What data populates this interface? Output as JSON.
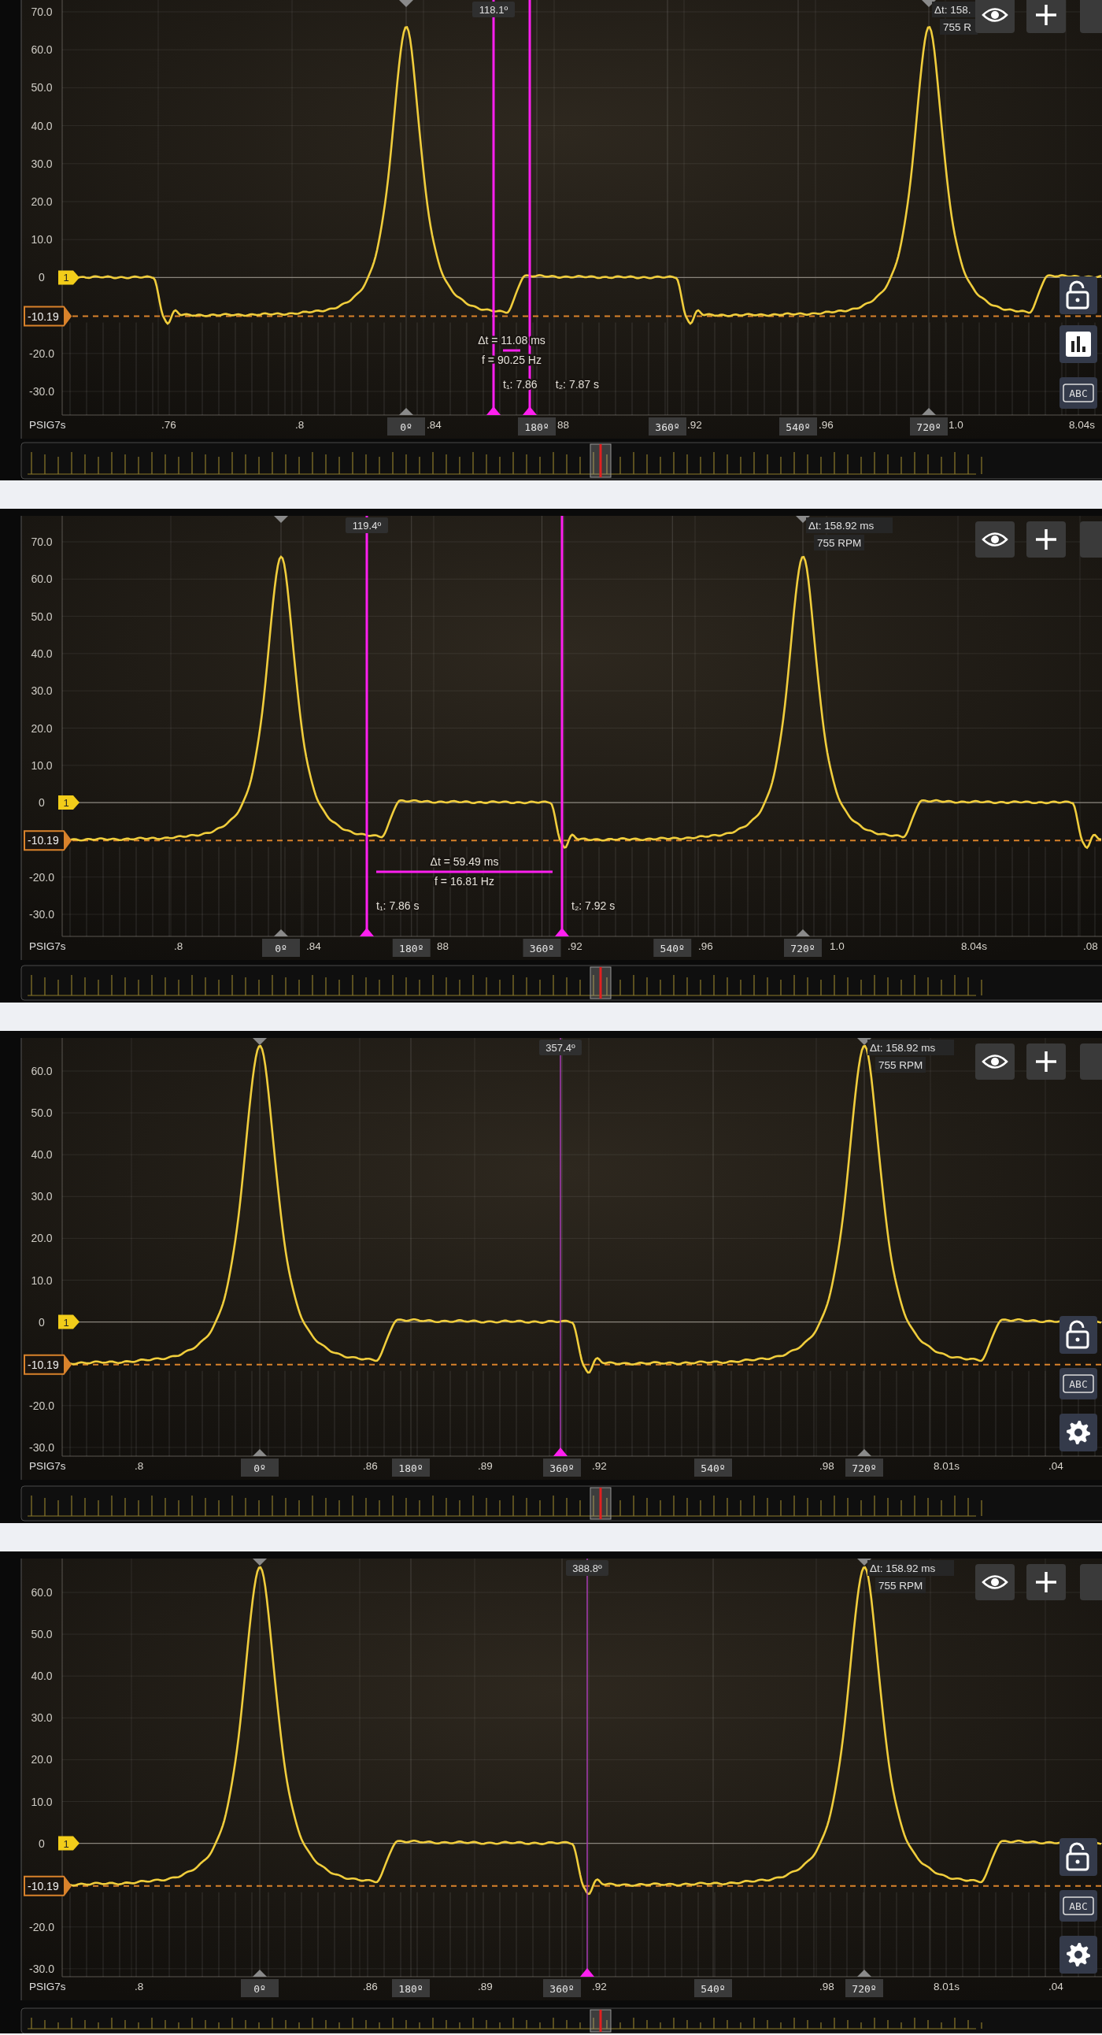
{
  "panels": [
    {
      "axis_label": "PSIG7s",
      "y_ticks": [
        "70.0",
        "60.0",
        "50.0",
        "40.0",
        "30.0",
        "20.0",
        "10.0",
        "0",
        "-20.0",
        "-30.0"
      ],
      "time_labels": [
        ".76",
        ".8",
        ".84",
        "88",
        ".92",
        ".96",
        "1.0",
        "8.04s"
      ],
      "degree_marks": [
        "0º",
        "180º",
        "360º",
        "540º",
        "720º"
      ],
      "channel_marker": "1",
      "reference_marker": "-10.19",
      "cursors": [
        {
          "angle": "118.1º",
          "highlighted": true
        },
        {
          "highlighted": true
        }
      ],
      "measurement": {
        "delta": "Δt = 11.08 ms",
        "frequency": "f = 90.25 Hz",
        "t1": "t₁: 7.86",
        "t2": "t₂: 7.87 s"
      },
      "period_readout": {
        "delta": "Δt: 158.",
        "rpm": "755 R"
      },
      "side_tools": [
        {
          "kind": "lock"
        },
        {
          "kind": "chart"
        },
        {
          "kind": "text",
          "label": "ABC"
        }
      ]
    },
    {
      "axis_label": "PSIG7s",
      "y_ticks": [
        "70.0",
        "60.0",
        "50.0",
        "40.0",
        "30.0",
        "20.0",
        "10.0",
        "0",
        "-20.0",
        "-30.0"
      ],
      "time_labels": [
        ".8",
        ".84",
        "88",
        ".92",
        ".96",
        "1.0",
        "8.04s",
        ".08"
      ],
      "degree_marks": [
        "0º",
        "180º",
        "360º",
        "540º",
        "720º"
      ],
      "channel_marker": "1",
      "reference_marker": "-10.19",
      "cursors": [
        {
          "angle": "119.4º",
          "highlighted": true
        },
        {
          "highlighted": true
        }
      ],
      "measurement": {
        "delta": "Δt = 59.49 ms",
        "frequency": "f = 16.81 Hz",
        "t1": "t₁: 7.86 s",
        "t2": "t₂: 7.92 s"
      },
      "period_readout": {
        "delta": "Δt: 158.92 ms",
        "rpm": "755 RPM"
      }
    },
    {
      "axis_label": "PSIG7s",
      "y_ticks": [
        "60.0",
        "50.0",
        "40.0",
        "30.0",
        "20.0",
        "10.0",
        "0",
        "-20.0",
        "-30.0"
      ],
      "time_labels": [
        ".8",
        ".86",
        ".89",
        ".92",
        ".98",
        "8.01s",
        ".04"
      ],
      "degree_marks": [
        "0º",
        "180º",
        "360º",
        "540º",
        "720º"
      ],
      "channel_marker": "1",
      "reference_marker": "-10.19",
      "cursors": [
        {
          "angle": "357.4º",
          "highlighted": false
        }
      ],
      "period_readout": {
        "delta": "Δt: 158.92 ms",
        "rpm": "755 RPM"
      },
      "side_tools": [
        {
          "kind": "lock"
        },
        {
          "kind": "text",
          "label": "ABC"
        },
        {
          "kind": "settings"
        }
      ]
    },
    {
      "axis_label": "PSIG7s",
      "y_ticks": [
        "60.0",
        "50.0",
        "40.0",
        "30.0",
        "20.0",
        "10.0",
        "0",
        "-20.0",
        "-30.0"
      ],
      "time_labels": [
        ".8",
        ".86",
        ".89",
        ".92",
        ".98",
        "8.01s",
        ".04"
      ],
      "degree_marks": [
        "0º",
        "180º",
        "360º",
        "540º",
        "720º"
      ],
      "channel_marker": "1",
      "reference_marker": "-10.19",
      "cursors": [
        {
          "angle": "388.8º",
          "highlighted": false
        }
      ],
      "period_readout": {
        "delta": "Δt: 158.92 ms",
        "rpm": "755 RPM"
      },
      "side_tools": [
        {
          "kind": "lock"
        },
        {
          "kind": "text",
          "label": "ABC"
        },
        {
          "kind": "settings"
        }
      ]
    }
  ]
}
